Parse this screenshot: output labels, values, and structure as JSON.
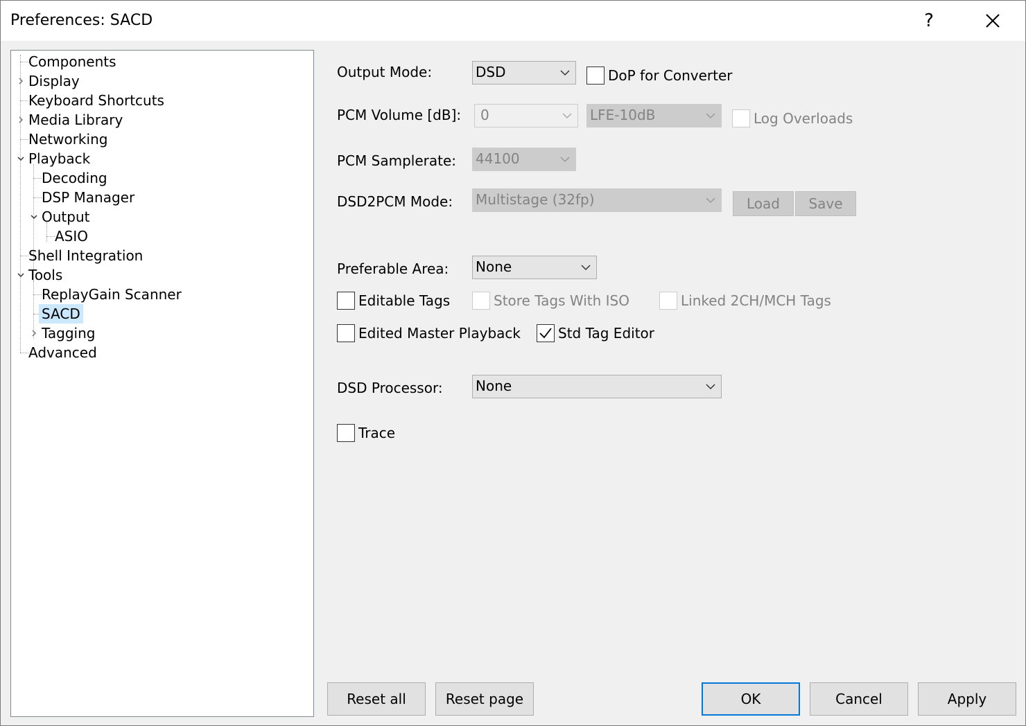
{
  "window": {
    "title": "Preferences: SACD",
    "help_label": "?",
    "close_icon": "close-icon"
  },
  "tree": {
    "items": [
      {
        "label": "Components",
        "selected": false
      },
      {
        "label": "Display",
        "selected": false,
        "expander": "collapsed"
      },
      {
        "label": "Keyboard Shortcuts",
        "selected": false
      },
      {
        "label": "Media Library",
        "selected": false,
        "expander": "collapsed"
      },
      {
        "label": "Networking",
        "selected": false
      },
      {
        "label": "Playback",
        "selected": false,
        "expander": "expanded"
      },
      {
        "label": "Decoding",
        "selected": false
      },
      {
        "label": "DSP Manager",
        "selected": false
      },
      {
        "label": "Output",
        "selected": false,
        "expander": "expanded"
      },
      {
        "label": "ASIO",
        "selected": false
      },
      {
        "label": "Shell Integration",
        "selected": false
      },
      {
        "label": "Tools",
        "selected": false,
        "expander": "expanded"
      },
      {
        "label": "ReplayGain Scanner",
        "selected": false
      },
      {
        "label": "SACD",
        "selected": true
      },
      {
        "label": "Tagging",
        "selected": false,
        "expander": "collapsed"
      },
      {
        "label": "Advanced",
        "selected": false
      }
    ]
  },
  "settings": {
    "output_mode": {
      "label": "Output Mode:",
      "value": "DSD"
    },
    "dop": {
      "label": "DoP for Converter",
      "checked": false,
      "enabled": true
    },
    "pcm_volume": {
      "label": "PCM Volume [dB]:",
      "value": "0",
      "lfe_value": "LFE-10dB",
      "enabled": false
    },
    "log_overloads": {
      "label": "Log Overloads",
      "checked": false,
      "enabled": false
    },
    "pcm_samplerate": {
      "label": "PCM Samplerate:",
      "value": "44100",
      "enabled": false
    },
    "dsd2pcm_mode": {
      "label": "DSD2PCM Mode:",
      "value": "Multistage (32fp)",
      "enabled": false
    },
    "load_label": "Load",
    "save_label": "Save",
    "preferable_area": {
      "label": "Preferable Area:",
      "value": "None"
    },
    "editable_tags": {
      "label": "Editable Tags",
      "checked": false,
      "enabled": true
    },
    "store_tags_with_iso": {
      "label": "Store Tags With ISO",
      "checked": false,
      "enabled": false
    },
    "linked_tags": {
      "label": "Linked 2CH/MCH Tags",
      "checked": false,
      "enabled": false
    },
    "edited_master_playback": {
      "label": "Edited Master Playback",
      "checked": false,
      "enabled": true
    },
    "std_tag_editor": {
      "label": "Std Tag Editor",
      "checked": true,
      "enabled": true
    },
    "dsd_processor": {
      "label": "DSD Processor:",
      "value": "None"
    },
    "trace": {
      "label": "Trace",
      "checked": false,
      "enabled": true
    }
  },
  "buttons": {
    "reset_all": "Reset all",
    "reset_page": "Reset page",
    "ok": "OK",
    "cancel": "Cancel",
    "apply": "Apply"
  },
  "colors": {
    "selection": "#cce8ff",
    "default_button_border": "#0078d7",
    "disabled_text": "#838383"
  }
}
